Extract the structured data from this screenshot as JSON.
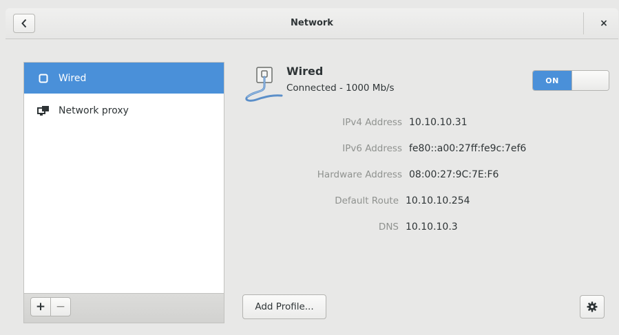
{
  "window": {
    "title": "Network",
    "close_label": "×"
  },
  "sidebar": {
    "items": [
      {
        "label": "Wired",
        "icon": "wired-connection-icon",
        "selected": true
      },
      {
        "label": "Network proxy",
        "icon": "network-proxy-icon",
        "selected": false
      }
    ],
    "toolbar": {
      "add_label": "+",
      "remove_label": "−"
    }
  },
  "detail": {
    "title": "Wired",
    "status": "Connected - 1000 Mb/s",
    "switch_label": "ON",
    "switch_on": true,
    "rows": [
      {
        "label": "IPv4 Address",
        "value": "10.10.10.31"
      },
      {
        "label": "IPv6 Address",
        "value": "fe80::a00:27ff:fe9c:7ef6"
      },
      {
        "label": "Hardware Address",
        "value": "08:00:27:9C:7E:F6"
      },
      {
        "label": "Default Route",
        "value": "10.10.10.254"
      },
      {
        "label": "DNS",
        "value": "10.10.10.3"
      }
    ],
    "add_profile_label": "Add Profile..."
  },
  "colors": {
    "accent": "#4a90d9",
    "background": "#e8e8e7"
  }
}
